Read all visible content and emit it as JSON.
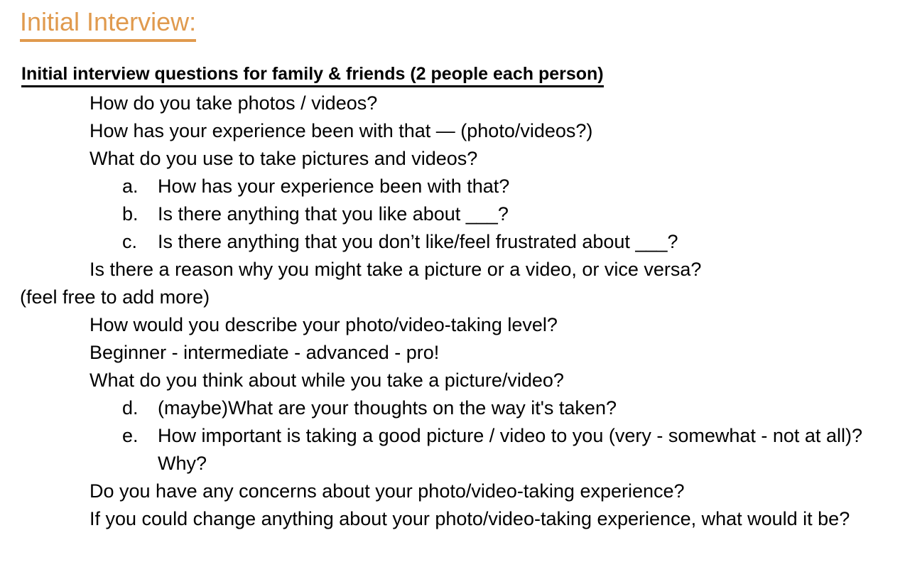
{
  "document": {
    "title": "Initial Interview:",
    "title_color": "#e09a4e",
    "subtitle": "Initial interview questions for family & friends (2 people each person)",
    "background_color": "#ffffff",
    "text_color": "#000000",
    "lines": [
      {
        "kind": "question",
        "text": "How do you take photos / videos?"
      },
      {
        "kind": "question",
        "text": "How has your experience been with that — (photo/videos?)"
      },
      {
        "kind": "question",
        "text": "What do you use to take pictures and videos?"
      },
      {
        "kind": "sub",
        "marker": "a.",
        "text": "How has your experience been with that?"
      },
      {
        "kind": "sub",
        "marker": "b.",
        "text": "Is there anything that you like about ___?"
      },
      {
        "kind": "sub",
        "marker": "c.",
        "text": "Is there anything that you don’t like/feel frustrated about ___?"
      },
      {
        "kind": "question",
        "text": "Is there a reason why you might take a picture or a video, or vice versa?"
      },
      {
        "kind": "flush",
        "text": "(feel free to add more)"
      },
      {
        "kind": "question",
        "text": "How would you describe your photo/video-taking level?"
      },
      {
        "kind": "question",
        "text": "Beginner - intermediate - advanced - pro!"
      },
      {
        "kind": "question",
        "text": "What do you think about while you take a picture/video?"
      },
      {
        "kind": "sub",
        "marker": "d.",
        "text": "(maybe)What are your thoughts on the way it's taken?"
      },
      {
        "kind": "sub",
        "marker": "e.",
        "text": "How important is taking a good picture / video to you (very - somewhat - not at all)? Why?"
      },
      {
        "kind": "question",
        "text": "Do you have any concerns about your photo/video-taking experience?"
      },
      {
        "kind": "question",
        "text": "If you could change anything about your photo/video-taking experience, what would it be?"
      }
    ]
  }
}
